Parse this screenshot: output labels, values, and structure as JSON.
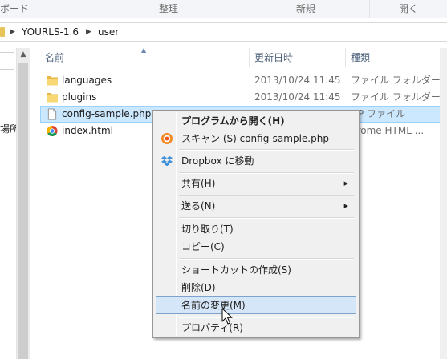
{
  "ribbon": {
    "groups": [
      "ボード",
      "整理",
      "新規",
      "開く"
    ]
  },
  "address": {
    "crumbs": [
      "YOURLS-1.6",
      "user"
    ]
  },
  "nav": {
    "items": [
      "場所"
    ]
  },
  "columns": {
    "name": "名前",
    "modified": "更新日時",
    "type": "種類"
  },
  "files": [
    {
      "name": "languages",
      "modified": "2013/10/24 11:45",
      "type": "ファイル フォルダー",
      "icon": "folder-icon"
    },
    {
      "name": "plugins",
      "modified": "2013/10/24 11:45",
      "type": "ファイル フォルダー",
      "icon": "folder-icon"
    },
    {
      "name": "config-sample.php",
      "modified": "",
      "type": "HP ファイル",
      "icon": "document-icon"
    },
    {
      "name": "index.html",
      "modified": "",
      "type": "hrome HTML ...",
      "icon": "chrome-icon"
    }
  ],
  "context_menu": {
    "items": [
      {
        "label": "プログラムから開く(H)",
        "bold": true
      },
      {
        "label": "スキャン (S) config-sample.php",
        "icon": "antivirus-icon"
      },
      {
        "label": "Dropbox に移動",
        "icon": "dropbox-icon"
      },
      {
        "label": "共有(H)",
        "submenu": true
      },
      {
        "label": "送る(N)",
        "submenu": true
      },
      {
        "label": "切り取り(T)"
      },
      {
        "label": "コピー(C)"
      },
      {
        "label": "ショートカットの作成(S)"
      },
      {
        "label": "削除(D)"
      },
      {
        "label": "名前の変更(M)",
        "hover": true
      },
      {
        "label": "プロパティ(R)"
      }
    ]
  },
  "colors": {
    "selection_fill": "#cce8ff",
    "selection_border": "#99d1ff",
    "menu_hover": "#d5e6f8",
    "header_text": "#4c607a"
  }
}
